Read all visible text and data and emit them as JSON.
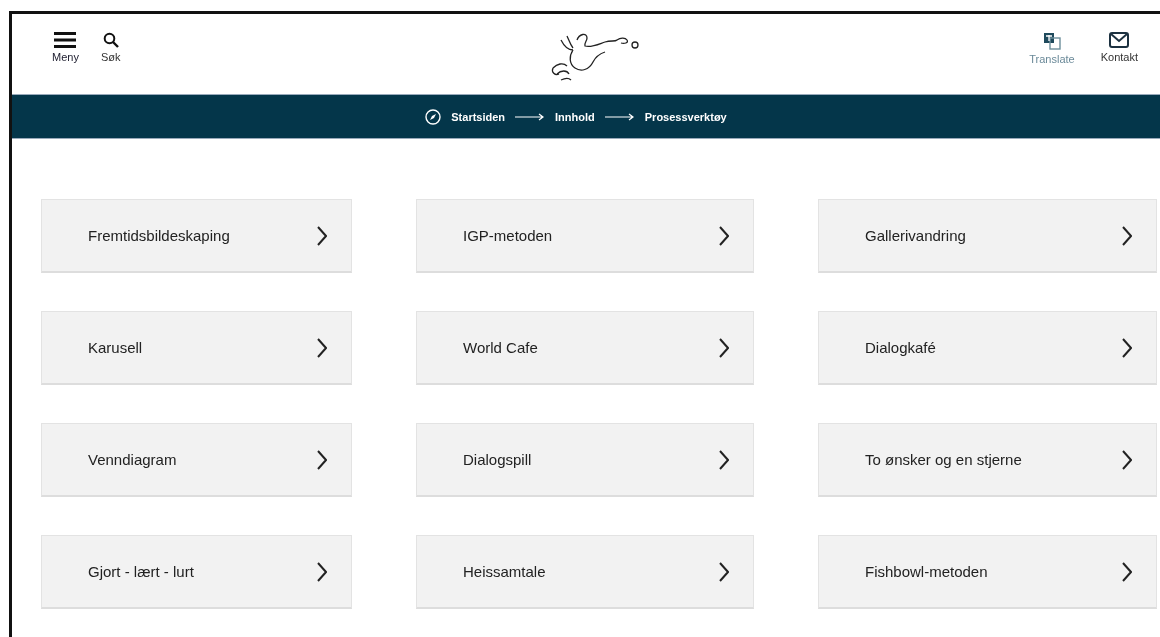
{
  "header": {
    "menu_label": "Meny",
    "search_label": "Søk",
    "translate_label": "Translate",
    "contact_label": "Kontakt"
  },
  "breadcrumb": [
    "Startsiden",
    "Innhold",
    "Prosessverktøy"
  ],
  "tiles": [
    {
      "label": "Fremtidsbildeskaping"
    },
    {
      "label": "IGP-metoden"
    },
    {
      "label": "Gallerivandring"
    },
    {
      "label": "Karusell"
    },
    {
      "label": "World Cafe"
    },
    {
      "label": "Dialogkafé"
    },
    {
      "label": "Venndiagram"
    },
    {
      "label": "Dialogspill"
    },
    {
      "label": "To ønsker og en stjerne"
    },
    {
      "label": "Gjort - lært - lurt"
    },
    {
      "label": "Heissamtale"
    },
    {
      "label": "Fishbowl-metoden"
    }
  ]
}
